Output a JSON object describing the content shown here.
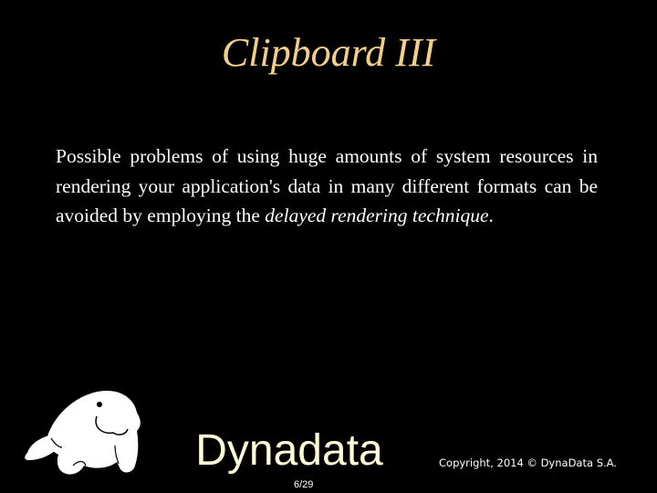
{
  "slide": {
    "title": "Clipboard III",
    "body": {
      "text_before": "Possible problems of using huge amounts of system resources in rendering your application's data in many different formats can be avoided by employing the ",
      "emphasis_1": "delayed rendering",
      "space": " ",
      "emphasis_2": "technique",
      "text_after": "."
    },
    "footer": {
      "brand": "Dynadata",
      "page_number": "6/29",
      "copyright": "Copyright, 2014 © DynaData S.A."
    },
    "icons": {
      "mascot": "manatee-mascot-icon"
    },
    "colors": {
      "background": "#000000",
      "title": "#f5cf8a",
      "body": "#ffffff",
      "brand": "#fffbd6"
    }
  }
}
